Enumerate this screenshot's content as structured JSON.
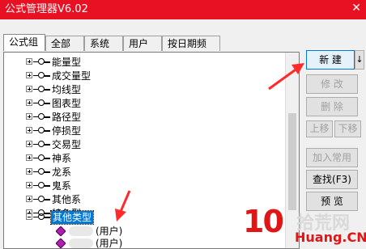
{
  "window": {
    "title": "公式管理器V6.02",
    "close": "✕"
  },
  "tabs": [
    "公式组",
    "全部",
    "系统",
    "用户",
    "按日期频度"
  ],
  "tree": {
    "items": [
      {
        "label": "能量型"
      },
      {
        "label": "成交量型"
      },
      {
        "label": "均线型"
      },
      {
        "label": "图表型"
      },
      {
        "label": "路径型"
      },
      {
        "label": "停损型"
      },
      {
        "label": "交易型"
      },
      {
        "label": "神系"
      },
      {
        "label": "龙系"
      },
      {
        "label": "鬼系"
      },
      {
        "label": "其他系"
      },
      {
        "label": "特色型"
      },
      {
        "label": "其他类型"
      }
    ],
    "children": [
      {
        "label": "(用户)"
      },
      {
        "label": "(用户)"
      }
    ]
  },
  "buttons": {
    "new": "新  建",
    "new_arrow": "↓",
    "modify": "修  改",
    "delete": "删  除",
    "move_up": "上移",
    "move_down": "下移",
    "add_common": "加入常用",
    "find": "查找(F3)",
    "preview": "预  览"
  },
  "watermark": {
    "number": "10",
    "brand": "拾荒网",
    "domain": "Huang.CN"
  },
  "colors": {
    "accent_red": "#e81123",
    "selection": "#0078d7",
    "pointer_arrow": "#ff2a2a"
  }
}
